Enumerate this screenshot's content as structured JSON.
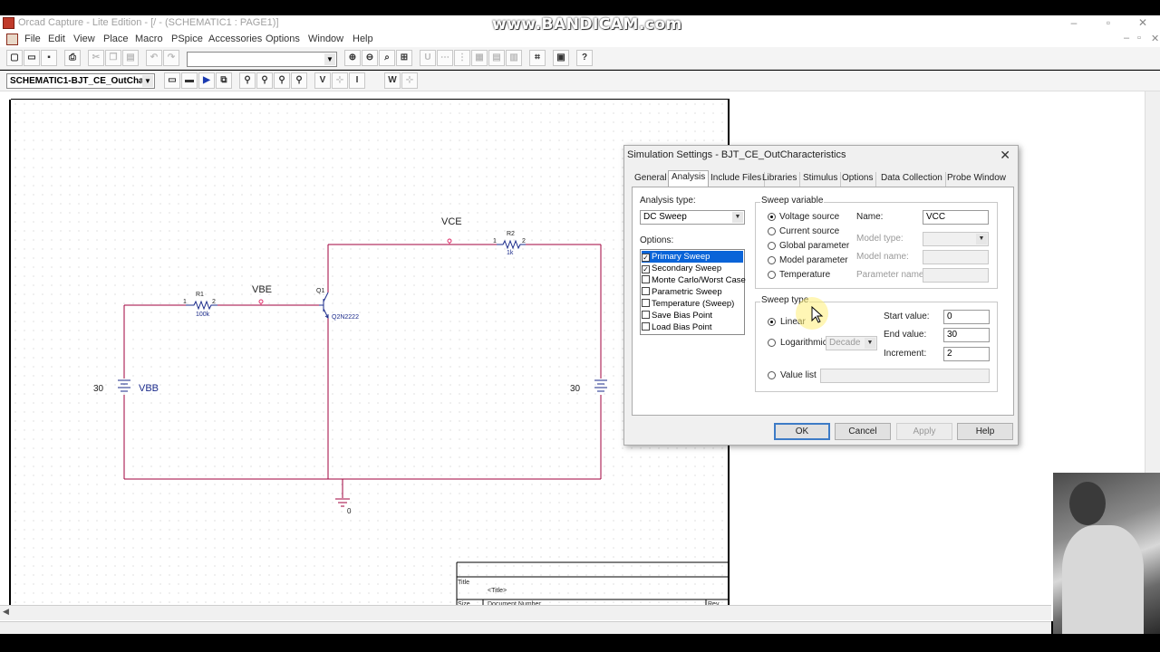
{
  "app": {
    "title": "Orcad Capture - Lite Edition - [/ - (SCHEMATIC1 : PAGE1)]",
    "watermark": "www.BANDICAM.com"
  },
  "menu": [
    "File",
    "Edit",
    "View",
    "Place",
    "Macro",
    "PSpice",
    "Accessories",
    "Options",
    "Window",
    "Help"
  ],
  "toolbar": {
    "part_combo": "",
    "profile_combo": "SCHEMATIC1-BJT_CE_OutCha",
    "text_buttons": [
      "V",
      "I",
      "W"
    ]
  },
  "schematic": {
    "labels": {
      "vce": "VCE",
      "vbe": "VBE",
      "vbb": "VBB",
      "vbb_value": "30",
      "vcc_value": "30",
      "r1_name": "R1",
      "r1_value": "100k",
      "r2_name": "R2",
      "r2_value": "1k",
      "q1_name": "Q1",
      "q1_model": "Q2N2222",
      "ground": "0",
      "pin1": "1",
      "pin2": "2"
    },
    "title_block": {
      "title_label": "Title",
      "title_value": "<Title>",
      "size_label": "Size",
      "doc_label": "Document Number",
      "rev_label": "Rev"
    }
  },
  "dialog": {
    "title": "Simulation Settings - BJT_CE_OutCharacteristics",
    "tabs": [
      "General",
      "Analysis",
      "Include Files",
      "Libraries",
      "Stimulus",
      "Options",
      "Data Collection",
      "Probe Window"
    ],
    "active_tab": "Analysis",
    "analysis_type_label": "Analysis type:",
    "analysis_type_value": "DC Sweep",
    "options_label": "Options:",
    "options": [
      {
        "label": "Primary Sweep",
        "checked": true,
        "selected": true
      },
      {
        "label": "Secondary Sweep",
        "checked": true,
        "selected": false
      },
      {
        "label": "Monte Carlo/Worst Case",
        "checked": false,
        "selected": false
      },
      {
        "label": "Parametric Sweep",
        "checked": false,
        "selected": false
      },
      {
        "label": "Temperature (Sweep)",
        "checked": false,
        "selected": false
      },
      {
        "label": "Save Bias Point",
        "checked": false,
        "selected": false
      },
      {
        "label": "Load Bias Point",
        "checked": false,
        "selected": false
      }
    ],
    "sweep_variable": {
      "group_title": "Sweep variable",
      "radios": [
        "Voltage source",
        "Current source",
        "Global parameter",
        "Model parameter",
        "Temperature"
      ],
      "selected": "Voltage source",
      "name_label": "Name:",
      "name_value": "VCC",
      "model_type_label": "Model type:",
      "model_name_label": "Model name:",
      "parameter_name_label": "Parameter name:"
    },
    "sweep_type": {
      "group_title": "Sweep type",
      "linear_label": "Linear",
      "log_label": "Logarithmic",
      "log_unit": "Decade",
      "value_list_label": "Value list",
      "selected": "Linear",
      "start_label": "Start value:",
      "start_value": "0",
      "end_label": "End value:",
      "end_value": "30",
      "increment_label": "Increment:",
      "increment_value": "2"
    },
    "buttons": {
      "ok": "OK",
      "cancel": "Cancel",
      "apply": "Apply",
      "help": "Help"
    }
  }
}
